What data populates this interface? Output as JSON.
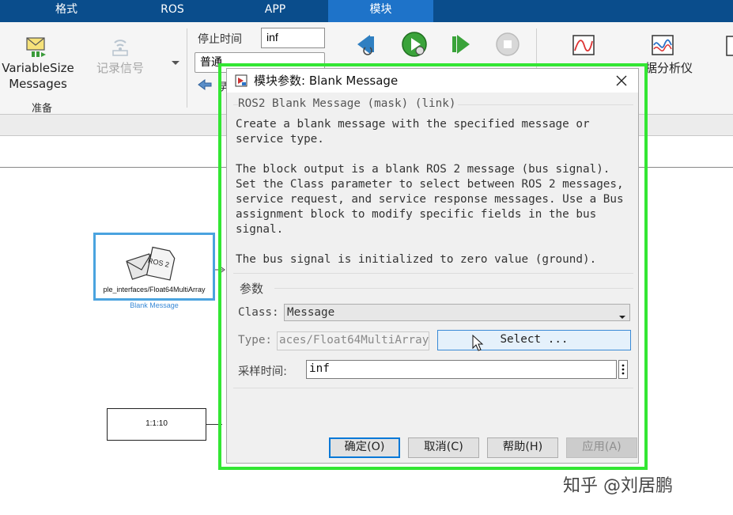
{
  "menu": {
    "tabs": [
      {
        "label": "格式"
      },
      {
        "label": "ROS"
      },
      {
        "label": "APP"
      },
      {
        "label": "模块"
      }
    ]
  },
  "toolstrip": {
    "variable_size_line1": "VariableSize",
    "variable_size_line2": "Messages",
    "record_signal": "记录信号",
    "prepare_section": "准备",
    "stop_time_label": "停止时间",
    "stop_time_value": "inf",
    "mode_value_visible": "普通",
    "analyzer_label": "据分析仪",
    "partial_text": "弄"
  },
  "canvas": {
    "blank_block_text": "ple_interfaces/Float64MultiArray",
    "blank_block_caption": "Blank Message",
    "ros2_icon_text": "ROS 2",
    "counter_block_text": "1:1:10"
  },
  "dialog": {
    "title": "模块参数: Blank Message",
    "header": "ROS2 Blank Message (mask) (link)",
    "description": "Create a blank message with the specified message or\nservice type.\n\nThe block output is a blank ROS 2 message (bus signal).\nSet the Class parameter to select between ROS 2 messages,\nservice request, and service response messages. Use a Bus\nassignment block to modify specific fields in the bus\nsignal.\n\nThe bus signal is initialized to zero value (ground).",
    "params_label": "参数",
    "class_label": "Class:",
    "class_value": "Message",
    "type_label": "Type:",
    "type_value": "aces/Float64MultiArray",
    "select_button": "Select ...",
    "sample_time_label": "采样时间:",
    "sample_time_value": "inf",
    "ok_button": "确定(O)",
    "cancel_button": "取消(C)",
    "help_button": "帮助(H)",
    "apply_button": "应用(A)"
  },
  "watermark": "知乎 @刘居鹏",
  "colors": {
    "menubar": "#0a4d8c",
    "active_tab": "#1e73c9",
    "highlight_frame": "#33e633",
    "selection_blue": "#4aa3df"
  }
}
